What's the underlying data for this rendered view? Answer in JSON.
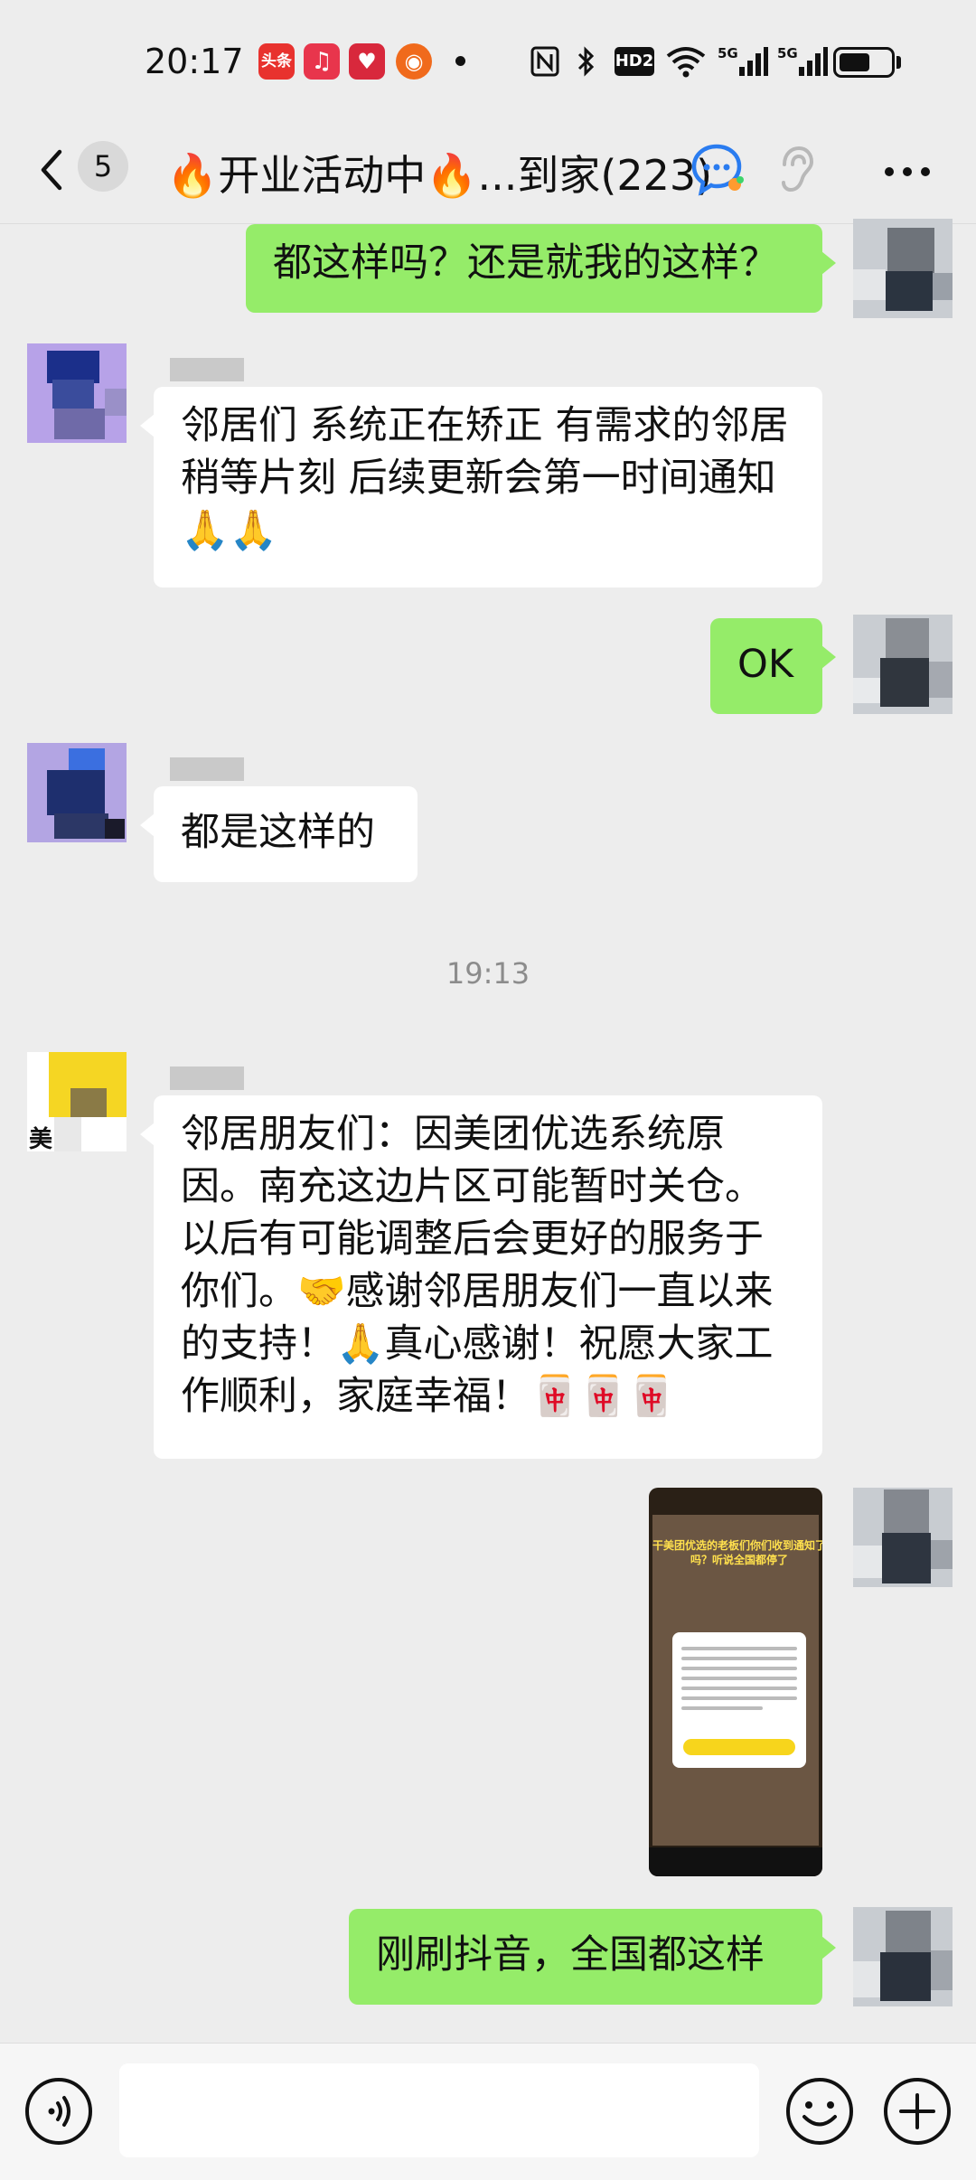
{
  "status_bar": {
    "time": "20:17",
    "app_icons": [
      {
        "name": "toutiao-app-icon",
        "label": "头条",
        "color": "#e8322e"
      },
      {
        "name": "music-app-icon",
        "label": "♫",
        "color": "#e8354c"
      },
      {
        "name": "gift-app-icon",
        "label": "♥",
        "color": "#d8283c"
      },
      {
        "name": "orange-app-icon",
        "label": "◉",
        "color": "#f06a1c"
      }
    ],
    "network": "5G",
    "hd_label": "HD2",
    "battery_level": 0.62
  },
  "nav": {
    "unread_count": "5",
    "title": "🔥开业活动中🔥...到家(223)"
  },
  "messages": [
    {
      "side": "right",
      "text": "都这样吗？还是就我的这样？"
    },
    {
      "side": "left",
      "text": "邻居们 系统正在矫正 有需求的邻居 稍等片刻 后续更新会第一时间通知🙏🙏"
    },
    {
      "side": "right",
      "text": "OK"
    },
    {
      "side": "left",
      "text": "都是这样的"
    },
    {
      "side": "left",
      "text": "邻居朋友们：因美团优选系统原因。南充这边片区可能暂时关仓。以后有可能调整后会更好的服务于你们。🤝感谢邻居朋友们一直以来的支持！🙏真心感谢！祝愿大家工作顺利，家庭幸福！🀄🀄🀄"
    },
    {
      "side": "right",
      "type": "image",
      "caption": "干美团优选的老板们你们收到通知了吗？听说全国都停了"
    },
    {
      "side": "right",
      "text": "刚刷抖音，全国都这样"
    }
  ],
  "timestamp": "19:13",
  "avatars": {
    "yellow_label": "美"
  },
  "colors": {
    "bubble_green": "#95ec69",
    "bubble_white": "#ffffff",
    "background": "#ededed"
  }
}
